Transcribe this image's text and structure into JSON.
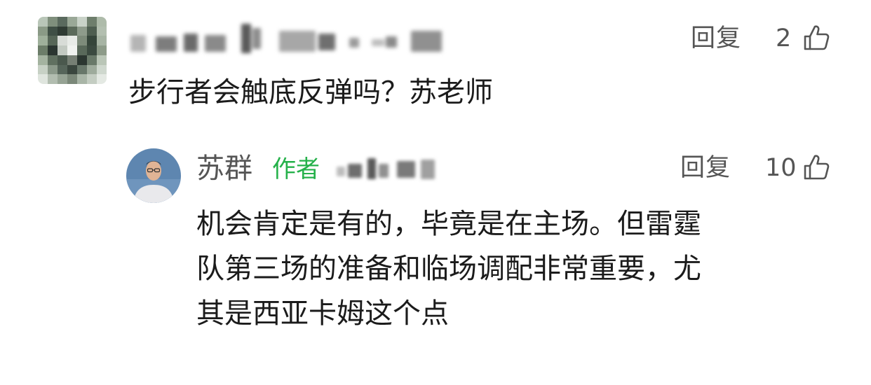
{
  "comment": {
    "reply_label": "回复",
    "like_count": "2",
    "text": "步行者会触底反弹吗？苏老师"
  },
  "reply": {
    "author_name": "苏群",
    "author_badge": "作者",
    "reply_label": "回复",
    "like_count": "10",
    "text_lines": [
      "机会肯定是有的，毕竟是在主场。但雷霆",
      "队第三场的准备和临场调配非常重要，尤",
      "其是西亚卡姆这个点"
    ]
  },
  "icons": {
    "like": "thumbs-up-icon"
  },
  "colors": {
    "badge_green": "#25b14a",
    "meta_gray": "#555555",
    "text": "#1b1b1b"
  }
}
